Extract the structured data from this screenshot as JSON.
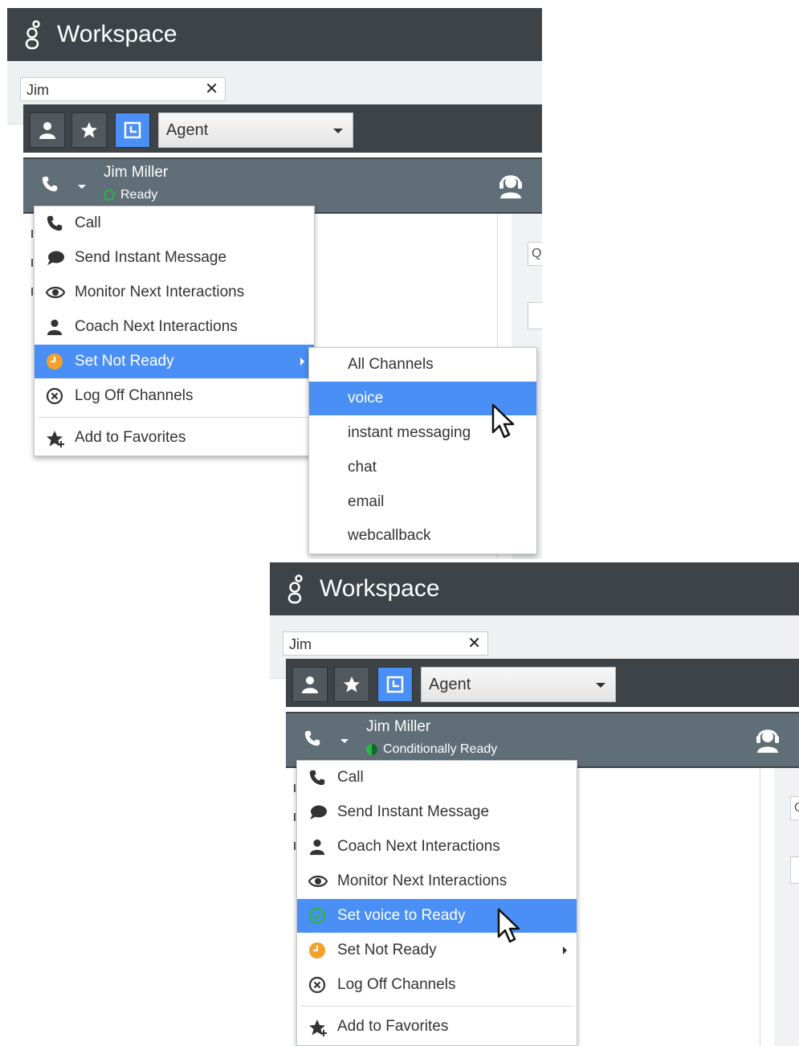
{
  "panels": [
    {
      "app_title": "Workspace",
      "search": {
        "value": "Jim",
        "close_glyph": "✕"
      },
      "agent_select": {
        "value": "Agent"
      },
      "contact": {
        "name": "Jim Miller",
        "status": "Ready"
      },
      "right_input_glyph": "Q",
      "menu": {
        "items": [
          {
            "label": "Call",
            "icon": "phone-icon"
          },
          {
            "label": "Send Instant Message",
            "icon": "chat-bubble-icon"
          },
          {
            "label": "Monitor Next Interactions",
            "icon": "eye-icon"
          },
          {
            "label": "Coach Next Interactions",
            "icon": "person-icon"
          },
          {
            "label": "Set Not Ready",
            "icon": "clock-orange-icon",
            "highlighted": true,
            "has_submenu": true
          },
          {
            "label": "Log Off Channels",
            "icon": "circle-x-icon"
          },
          {
            "label": "Add to Favorites",
            "icon": "star-plus-icon"
          }
        ]
      },
      "submenu": {
        "items": [
          {
            "label": "All Channels"
          },
          {
            "label": "voice",
            "highlighted": true
          },
          {
            "label": "instant messaging"
          },
          {
            "label": "chat"
          },
          {
            "label": "email"
          },
          {
            "label": "webcallback"
          }
        ]
      }
    },
    {
      "app_title": "Workspace",
      "search": {
        "value": "Jim",
        "close_glyph": "✕"
      },
      "agent_select": {
        "value": "Agent"
      },
      "contact": {
        "name": "Jim Miller",
        "status": "Conditionally Ready"
      },
      "right_input_glyph": "Q",
      "menu": {
        "items": [
          {
            "label": "Call",
            "icon": "phone-icon"
          },
          {
            "label": "Send Instant Message",
            "icon": "chat-bubble-icon"
          },
          {
            "label": "Coach Next Interactions",
            "icon": "person-icon"
          },
          {
            "label": "Monitor Next Interactions",
            "icon": "eye-icon"
          },
          {
            "label": "Set voice to Ready",
            "icon": "check-circle-green-icon",
            "highlighted": true
          },
          {
            "label": "Set Not Ready",
            "icon": "clock-orange-icon",
            "has_submenu": true
          },
          {
            "label": "Log Off Channels",
            "icon": "circle-x-icon"
          },
          {
            "label": "Add to Favorites",
            "icon": "star-plus-icon"
          }
        ]
      }
    }
  ],
  "colors": {
    "titlebar": "#3d4347",
    "highlight": "#4a8ff5",
    "contact_row": "#5f6e77",
    "ready_green": "#2cb34a",
    "not_ready_orange": "#f5a02a"
  }
}
